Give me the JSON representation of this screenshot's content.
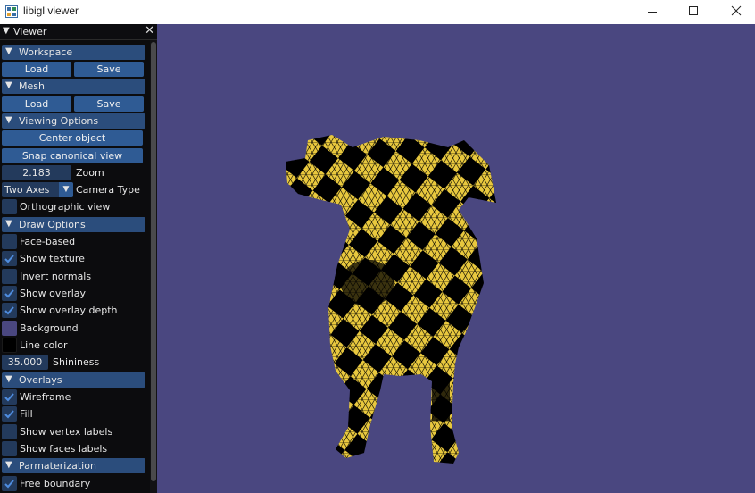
{
  "window": {
    "title": "libigl viewer",
    "controls": {
      "minimize": "minimize-icon",
      "maximize": "maximize-icon",
      "close": "close-icon"
    }
  },
  "panel": {
    "title": "Viewer",
    "sections": {
      "workspace": {
        "label": "Workspace",
        "load": "Load",
        "save": "Save"
      },
      "mesh": {
        "label": "Mesh",
        "load": "Load",
        "save": "Save"
      },
      "viewing": {
        "label": "Viewing Options",
        "center": "Center object",
        "snap": "Snap canonical view",
        "zoom_value": "2.183",
        "zoom_label": "Zoom",
        "camera_value": "Two Axes",
        "camera_label": "Camera Type",
        "ortho_label": "Orthographic view",
        "ortho_checked": false
      },
      "draw": {
        "label": "Draw Options",
        "face_based": {
          "label": "Face-based",
          "checked": false
        },
        "show_texture": {
          "label": "Show texture",
          "checked": true
        },
        "invert_normals": {
          "label": "Invert normals",
          "checked": false
        },
        "show_overlay": {
          "label": "Show overlay",
          "checked": true
        },
        "show_overlay_depth": {
          "label": "Show overlay depth",
          "checked": true
        },
        "background": {
          "label": "Background",
          "color": "#4a4780"
        },
        "line_color": {
          "label": "Line color",
          "color": "#000000"
        },
        "shininess_value": "35.000",
        "shininess_label": "Shininess"
      },
      "overlays": {
        "label": "Overlays",
        "wireframe": {
          "label": "Wireframe",
          "checked": true
        },
        "fill": {
          "label": "Fill",
          "checked": true
        },
        "vertex_labels": {
          "label": "Show vertex labels",
          "checked": false
        },
        "face_labels": {
          "label": "Show faces labels",
          "checked": false
        }
      },
      "param": {
        "label": "Parmaterization",
        "free_boundary": {
          "label": "Free boundary",
          "checked": true
        }
      }
    }
  },
  "colors": {
    "viewport_bg": "#4a4780",
    "panel_bg": "#0c0c0e",
    "header": "#2b4d7c",
    "button": "#2f5b94",
    "check_bg": "#233a5c",
    "checkmark": "#4f8de0",
    "mesh_yellow": "#e8c83e"
  }
}
